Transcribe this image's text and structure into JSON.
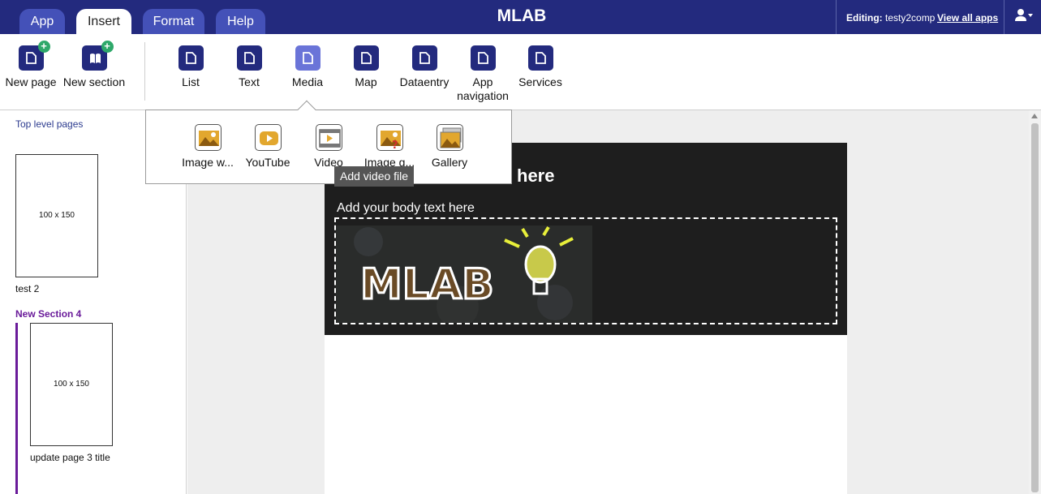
{
  "topbar": {
    "tabs": [
      {
        "label": "App"
      },
      {
        "label": "Insert"
      },
      {
        "label": "Format"
      },
      {
        "label": "Help"
      }
    ],
    "active_tab": "Insert",
    "app_title": "MLAB",
    "editing_label": "Editing:",
    "editing_value": "testy2comp",
    "view_all_apps": "View all apps",
    "user_icon": "user-dropdown-icon"
  },
  "ribbon": {
    "new_page": "New page",
    "new_section": "New section",
    "items": [
      {
        "label": "List"
      },
      {
        "label": "Text"
      },
      {
        "label": "Media"
      },
      {
        "label": "Map"
      },
      {
        "label": "Dataentry"
      },
      {
        "label": "App navigation"
      },
      {
        "label": "Services"
      }
    ],
    "highlighted": "Media"
  },
  "media_menu": {
    "items": [
      {
        "label": "Image w...",
        "icon": "image-icon"
      },
      {
        "label": "YouTube",
        "icon": "youtube-icon"
      },
      {
        "label": "Video",
        "icon": "video-icon"
      },
      {
        "label": "Image g...",
        "icon": "image-quiz-icon"
      },
      {
        "label": "Gallery",
        "icon": "gallery-icon"
      }
    ],
    "tooltip": "Add video file"
  },
  "sidebar": {
    "top_level_title": "Top level pages",
    "pages": [
      {
        "thumb": "100 x 150",
        "label": "test 2"
      }
    ],
    "section_title": "New Section 4",
    "section_pages": [
      {
        "thumb": "100 x 150",
        "label": "update page 3 title"
      }
    ]
  },
  "page_preview": {
    "heading": "here",
    "body_text": "Add your body text here",
    "image_text": "MLAB"
  },
  "colors": {
    "topbar": "#232a7e",
    "tab": "#4451b8",
    "section": "#6a1b9a",
    "accent_green": "#2ea86a",
    "media_icon": "#e2a72e"
  }
}
